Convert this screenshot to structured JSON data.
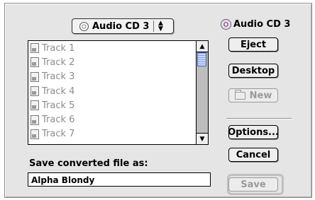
{
  "volume_popup": {
    "label": "Audio CD 3",
    "arrows": "▲▼"
  },
  "volume_label": "Audio CD 3",
  "file_list": {
    "items": [
      "Track 1",
      "Track 2",
      "Track 3",
      "Track 4",
      "Track 5",
      "Track 6",
      "Track 7"
    ]
  },
  "buttons": {
    "eject": "Eject",
    "desktop": "Desktop",
    "new": "New",
    "options": "Options...",
    "cancel": "Cancel",
    "save": "Save"
  },
  "save_caption": "Save converted file as:",
  "filename_value": "Alpha Blondy",
  "icons": {
    "cd": "cd-icon",
    "file": "audio-file-icon",
    "folder": "new-folder-icon",
    "scroll_up": "▲",
    "scroll_down": "▼"
  }
}
